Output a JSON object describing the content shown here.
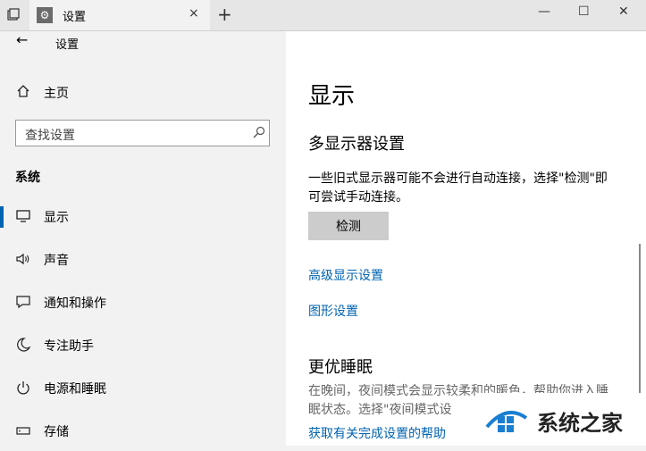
{
  "window": {
    "tab_title": "设置",
    "new_tab_symbol": "+",
    "close_tab_symbol": "×",
    "minimize_symbol": "—",
    "maximize_symbol": "☐",
    "close_symbol": "✕"
  },
  "sidebar": {
    "back_symbol": "←",
    "title": "设置",
    "home_label": "主页",
    "search_placeholder": "查找设置",
    "section_label": "系统",
    "items": [
      {
        "label": "显示",
        "icon": "monitor-icon",
        "active": true
      },
      {
        "label": "声音",
        "icon": "speaker-icon",
        "active": false
      },
      {
        "label": "通知和操作",
        "icon": "notification-icon",
        "active": false
      },
      {
        "label": "专注助手",
        "icon": "moon-icon",
        "active": false
      },
      {
        "label": "电源和睡眠",
        "icon": "power-icon",
        "active": false
      },
      {
        "label": "存储",
        "icon": "storage-icon",
        "active": false
      }
    ]
  },
  "main": {
    "title": "显示",
    "multi_display_heading": "多显示器设置",
    "multi_display_desc": "一些旧式显示器可能不会进行自动连接，选择\"检测\"即可尝试手动连接。",
    "detect_button": "检测",
    "advanced_link": "高级显示设置",
    "graphics_link": "图形设置",
    "sleep_heading": "更优睡眠",
    "sleep_desc": "在晚间，夜间模式会显示较柔和的暖色，帮助你进入睡眠状态。选择\"夜间模式设",
    "help_link": "获取有关完成设置的帮助"
  },
  "watermark": {
    "text": "系统之家"
  },
  "colors": {
    "accent": "#0063b1",
    "sidebar_bg": "#f2f2f2",
    "main_bg": "#ffffff"
  }
}
